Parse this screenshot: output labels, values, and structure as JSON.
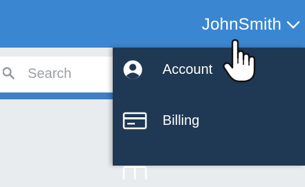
{
  "header": {
    "username": "JohnSmith"
  },
  "search": {
    "placeholder": "Search"
  },
  "dropdown": {
    "items": [
      {
        "label": "Account",
        "icon": "user-circle-icon"
      },
      {
        "label": "Billing",
        "icon": "credit-card-icon"
      },
      {
        "label": "",
        "icon": "id-card-icon"
      }
    ]
  },
  "colors": {
    "header": "#3a86d1",
    "dropdown": "#1f3853",
    "search_underline": "#3f7fc4",
    "page": "#e9ecef"
  }
}
